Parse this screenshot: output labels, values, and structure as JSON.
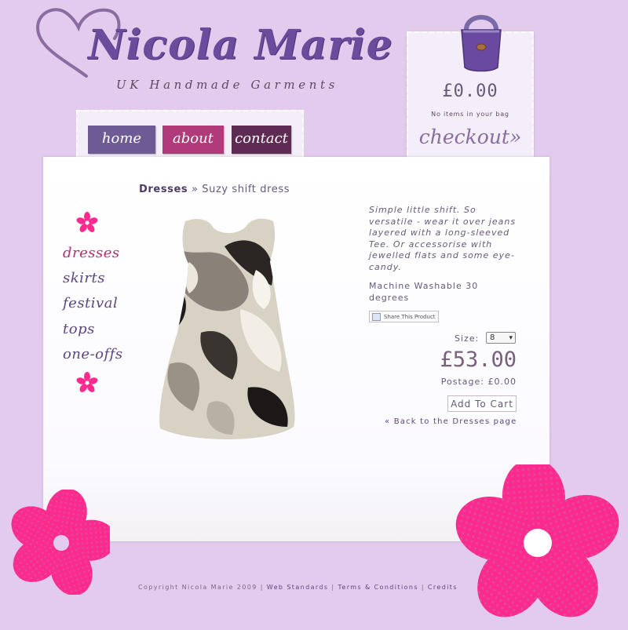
{
  "brand": {
    "title": "Nicola Marie",
    "tagline": "UK Handmade Garments",
    "heart_color": "#8a6ca0",
    "title_color": "#6a4b9c"
  },
  "bag": {
    "total": "£0.00",
    "items_text": "No items in your bag",
    "checkout_label": "checkout»",
    "icon": "handbag-icon"
  },
  "nav": {
    "home": "home",
    "about": "about",
    "contact": "contact"
  },
  "breadcrumb": {
    "category": "Dresses",
    "separator": " » ",
    "current": "Suzy shift dress"
  },
  "categories": [
    "dresses",
    "skirts",
    "festival",
    "tops",
    "one-offs"
  ],
  "product": {
    "description": "Simple little shift. So versatile - wear it over jeans layered with a long-sleeved Tee. Or accessorise with jewelled flats and some eye-candy.",
    "care": "Machine Washable 30 degrees",
    "share_label": "Share This Product",
    "size_label": "Size:",
    "size_value": "8",
    "price": "£53.00",
    "postage": "Postage: £0.00",
    "add_to_cart": "Add To Cart",
    "back_link": "« Back to the Dresses page"
  },
  "footer": {
    "copyright": "Copyright Nicola Marie 2009",
    "sep": " | ",
    "links": [
      "Web Standards",
      "Terms & Conditions",
      "Credits"
    ]
  },
  "colors": {
    "background": "#e2cbec",
    "accent_pink": "#ff2a8f",
    "nav_home": "#6e5a95",
    "nav_about": "#b03a7a",
    "nav_contact": "#5e2b54"
  }
}
